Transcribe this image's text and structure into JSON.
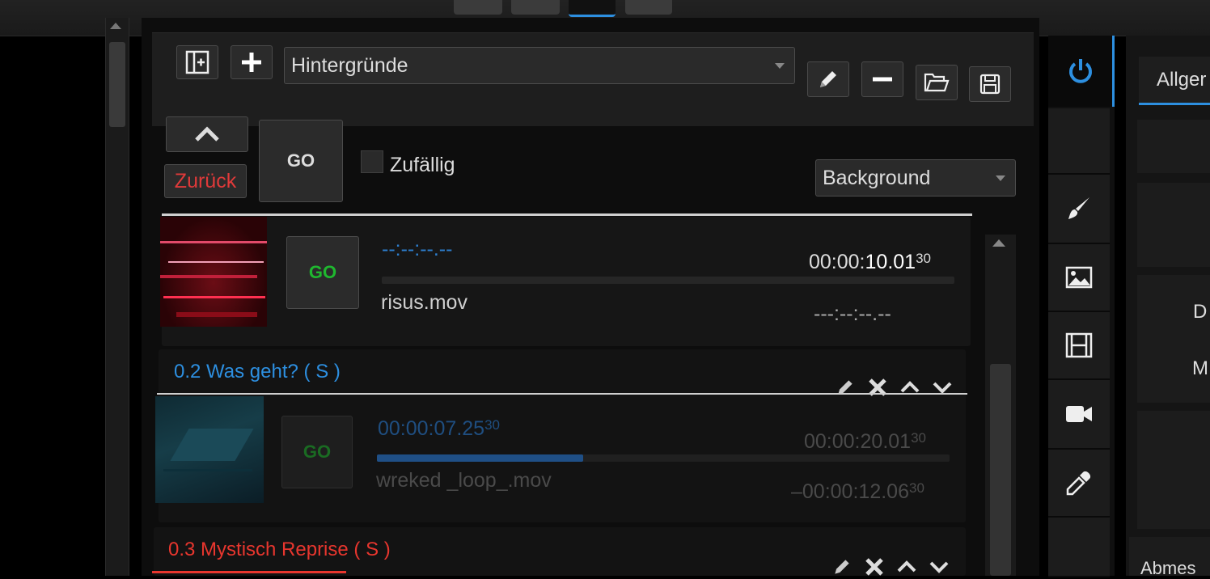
{
  "toolbar": {
    "playlist_select": "Hintergründe"
  },
  "controls": {
    "back_label": "Zurück",
    "go_label": "GO",
    "random_label": "Zufällig",
    "layer_select": "Background"
  },
  "clips": [
    {
      "go_label": "GO",
      "elapsed": "--:--:--.--",
      "duration_main": "00:00:",
      "duration_bold": "10.01",
      "duration_frames": "30",
      "filename": "risus.mov",
      "remaining": "---:--:--.--"
    },
    {
      "header": "0.2 Was geht? ( S )",
      "go_label": "GO",
      "elapsed_main": "00:00:07.25",
      "elapsed_frames": "30",
      "duration_main": "00:00:20.01",
      "duration_frames": "30",
      "filename": "wreked _loop_.mov",
      "remaining_main": "–00:00:12.06",
      "remaining_frames": "30",
      "progress": 0.36
    },
    {
      "header": "0.3 Mystisch Reprise ( S )"
    }
  ],
  "right_panel": {
    "tab_label": "Allger",
    "label_d": "D",
    "label_m": "M",
    "label_abmes": "Abmes"
  },
  "colors": {
    "accent_blue": "#2d8fe0",
    "go_green": "#1fb82f",
    "back_red": "#e03a3a",
    "header_red": "#e8362e"
  }
}
